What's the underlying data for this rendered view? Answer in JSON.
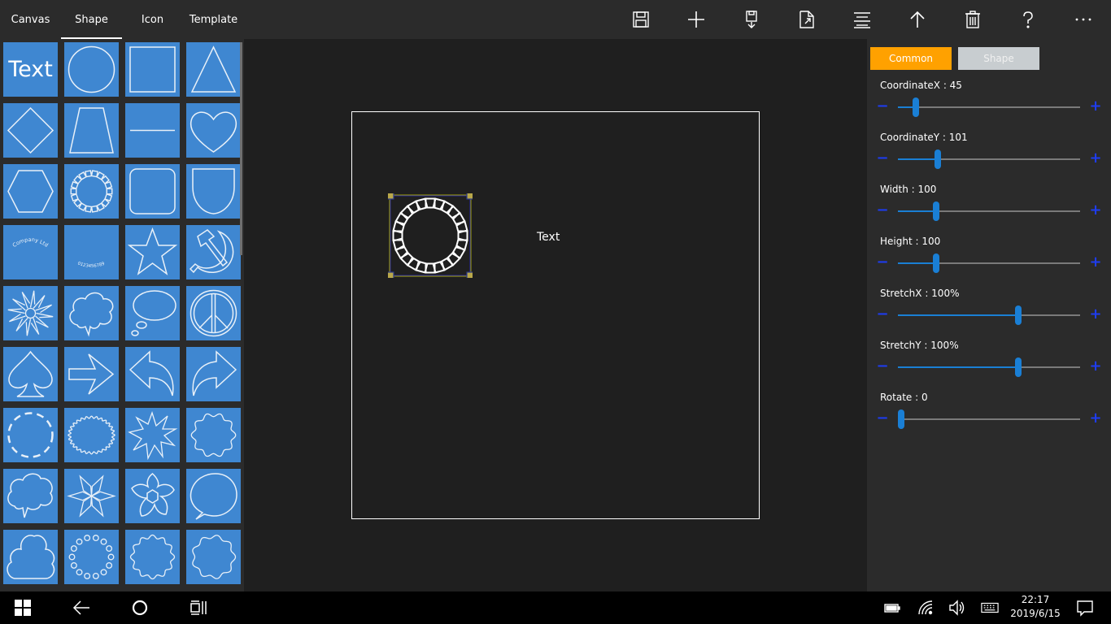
{
  "tabs": [
    {
      "label": "Canvas"
    },
    {
      "label": "Shape"
    },
    {
      "label": "Icon"
    },
    {
      "label": "Template"
    }
  ],
  "active_tab": "Shape",
  "toolbar_icons": [
    "save-icon",
    "add-icon",
    "save-as-icon",
    "export-icon",
    "align-icon",
    "bring-forward-icon",
    "delete-icon",
    "help-icon",
    "more-icon"
  ],
  "palette": {
    "text_tile_label": "Text",
    "shapes": [
      "text",
      "circle",
      "square",
      "triangle",
      "diamond",
      "trapezoid",
      "line",
      "heart",
      "hexagon",
      "ring-of-squares",
      "rounded-square",
      "shield",
      "arc-text-top",
      "arc-text-bottom",
      "star",
      "hammer-sickle",
      "flower-burst",
      "cloud-callout",
      "thought-bubble",
      "peace",
      "spade",
      "arrow-right",
      "arrow-back",
      "arrow-curve",
      "dashed-circle",
      "scalloped-oval",
      "explosion",
      "wavy-circle",
      "cloud-callout-2",
      "pinwheel",
      "flower",
      "speech-bubble",
      "club-cloud",
      "dotted-circle",
      "wavy-circle-2",
      "scalloped-circle"
    ],
    "arc_text_top": "Company Ltd",
    "arc_text_bottom": "0123456789"
  },
  "canvas": {
    "text_element": "Text"
  },
  "props": {
    "tab_common": "Common",
    "tab_shape": "Shape",
    "minus_symbol": "−",
    "plus_symbol": "+",
    "items": [
      {
        "label": "CoordinateX : 45",
        "fraction": 0.1
      },
      {
        "label": "CoordinateY : 101",
        "fraction": 0.22
      },
      {
        "label": "Width : 100",
        "fraction": 0.21
      },
      {
        "label": "Height : 100",
        "fraction": 0.21
      },
      {
        "label": "StretchX : 100%",
        "fraction": 0.66
      },
      {
        "label": "StretchY : 100%",
        "fraction": 0.66
      },
      {
        "label": "Rotate : 0",
        "fraction": 0.02
      }
    ]
  },
  "taskbar": {
    "time": "22:17",
    "date": "2019/6/15"
  },
  "colors": {
    "accent_blue": "#3f87d1",
    "common_tab": "#ffa100",
    "slider": "#1a7fd5",
    "step_buttons": "#1e3cf0"
  }
}
